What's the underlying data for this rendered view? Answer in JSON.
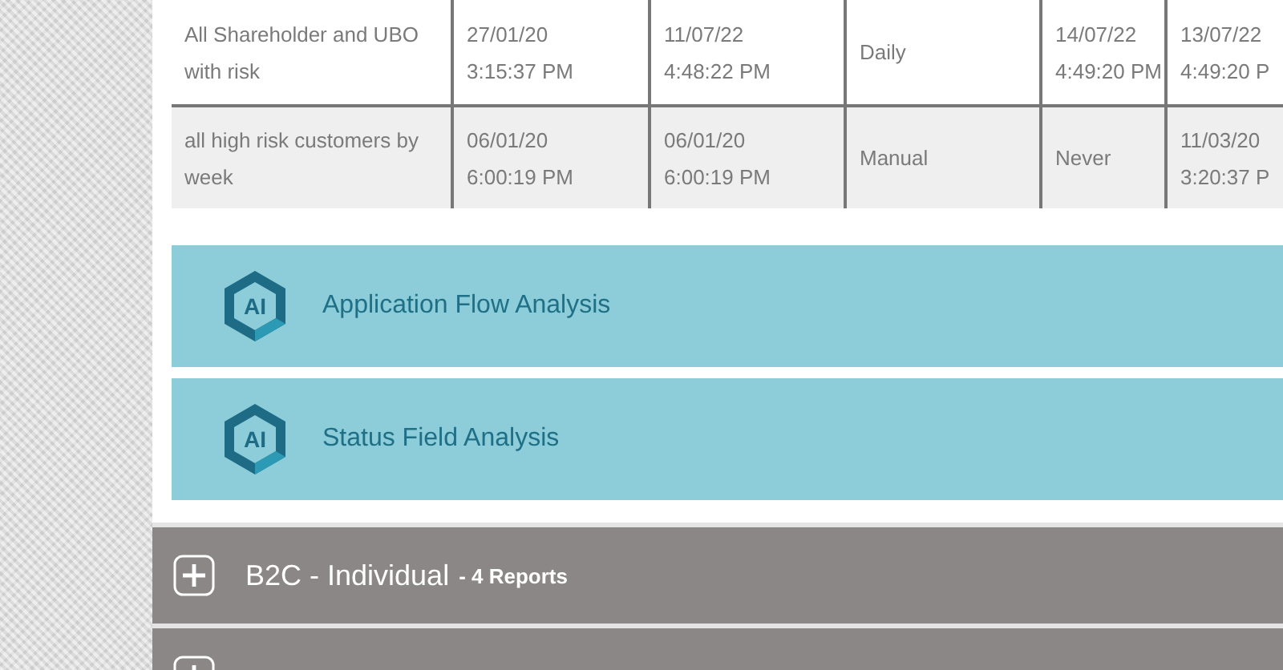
{
  "report_table": {
    "rows": [
      {
        "cells": [
          "All Shareholder and UBO with risk",
          "27/01/20\n3:15:37 PM",
          "11/07/22\n4:48:22 PM",
          "Daily",
          "14/07/22\n4:49:20 PM",
          "13/07/22\n4:49:20 P"
        ],
        "shaded": false
      },
      {
        "cells": [
          "all high risk customers by week",
          "06/01/20\n6:00:19 PM",
          "06/01/20\n6:00:19 PM",
          "Manual",
          "Never",
          "11/03/20\n3:20:37 P"
        ],
        "shaded": true
      }
    ]
  },
  "analysis_links": [
    {
      "icon_text": "AI",
      "label": "Application Flow Analysis"
    },
    {
      "icon_text": "AI",
      "label": "Status Field Analysis"
    }
  ],
  "report_groups": [
    {
      "title": "B2C - Individual",
      "count": "- 4 Reports",
      "expanded": false
    },
    {
      "expanded": false
    }
  ]
}
